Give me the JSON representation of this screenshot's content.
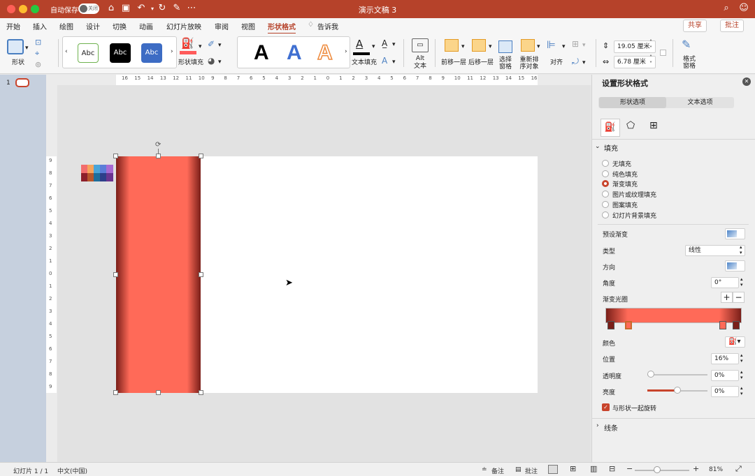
{
  "titlebar": {
    "autosave_label": "自动保存",
    "autosave_state": "关闭",
    "title": "演示文稿 3"
  },
  "tabs": [
    {
      "label": "开始"
    },
    {
      "label": "插入"
    },
    {
      "label": "绘图"
    },
    {
      "label": "设计"
    },
    {
      "label": "切换"
    },
    {
      "label": "动画"
    },
    {
      "label": "幻灯片放映"
    },
    {
      "label": "审阅"
    },
    {
      "label": "视图"
    },
    {
      "label": "形状格式"
    },
    {
      "label": "告诉我"
    }
  ],
  "share_label": "共享",
  "comments_label": "批注",
  "ribbon": {
    "shapes_label": "形状",
    "style_samples": [
      "Abc",
      "Abc",
      "Abc"
    ],
    "shape_fill_label": "形状填充",
    "wordart_samples": [
      "A",
      "A",
      "A"
    ],
    "text_fill_label": "文本填充",
    "alt_text_label": "Alt\n文本",
    "bring_forward_label": "前移一层",
    "send_backward_label": "后移一层",
    "selection_pane_label": "选择\n窗格",
    "reorder_label": "重新排\n序对象",
    "align_label": "对齐",
    "height_value": "19.05 厘米",
    "width_value": "6.78 厘米",
    "format_pane_label": "格式\n窗格"
  },
  "slide_number": "1",
  "ruler_h_labels": [
    "16",
    "15",
    "14",
    "13",
    "12",
    "11",
    "10",
    "9",
    "8",
    "7",
    "6",
    "5",
    "4",
    "3",
    "2",
    "1",
    "0",
    "1",
    "2",
    "3",
    "4",
    "5",
    "6",
    "7",
    "8",
    "9",
    "10",
    "11",
    "12",
    "13",
    "14",
    "15",
    "16"
  ],
  "ruler_v_labels": [
    "9",
    "8",
    "7",
    "6",
    "5",
    "4",
    "3",
    "2",
    "1",
    "0",
    "1",
    "2",
    "3",
    "4",
    "5",
    "6",
    "7",
    "8",
    "9"
  ],
  "panel": {
    "title": "设置形状格式",
    "tab_shape": "形状选项",
    "tab_text": "文本选项",
    "fill_section": "填充",
    "fill_options": [
      "无填充",
      "纯色填充",
      "渐变填充",
      "图片或纹理填充",
      "图案填充",
      "幻灯片背景填充"
    ],
    "selected_fill": "渐变填充",
    "preset_label": "预设渐变",
    "type_label": "类型",
    "type_value": "线性",
    "direction_label": "方向",
    "angle_label": "角度",
    "angle_value": "0°",
    "stops_label": "渐变光圈",
    "color_label": "颜色",
    "position_label": "位置",
    "position_value": "16%",
    "transparency_label": "透明度",
    "transparency_value": "0%",
    "brightness_label": "亮度",
    "brightness_value": "0%",
    "rotate_label": "与形状一起旋转",
    "line_section": "线条"
  },
  "colors": {
    "accent": "#b6422a",
    "shape_dark": "#7a1f19",
    "shape_light": "#ff6a58"
  },
  "status": {
    "slide_label": "幻灯片 1 / 1",
    "language": "中文(中国)",
    "notes_label": "备注",
    "comments_label": "批注",
    "zoom": "81%"
  }
}
